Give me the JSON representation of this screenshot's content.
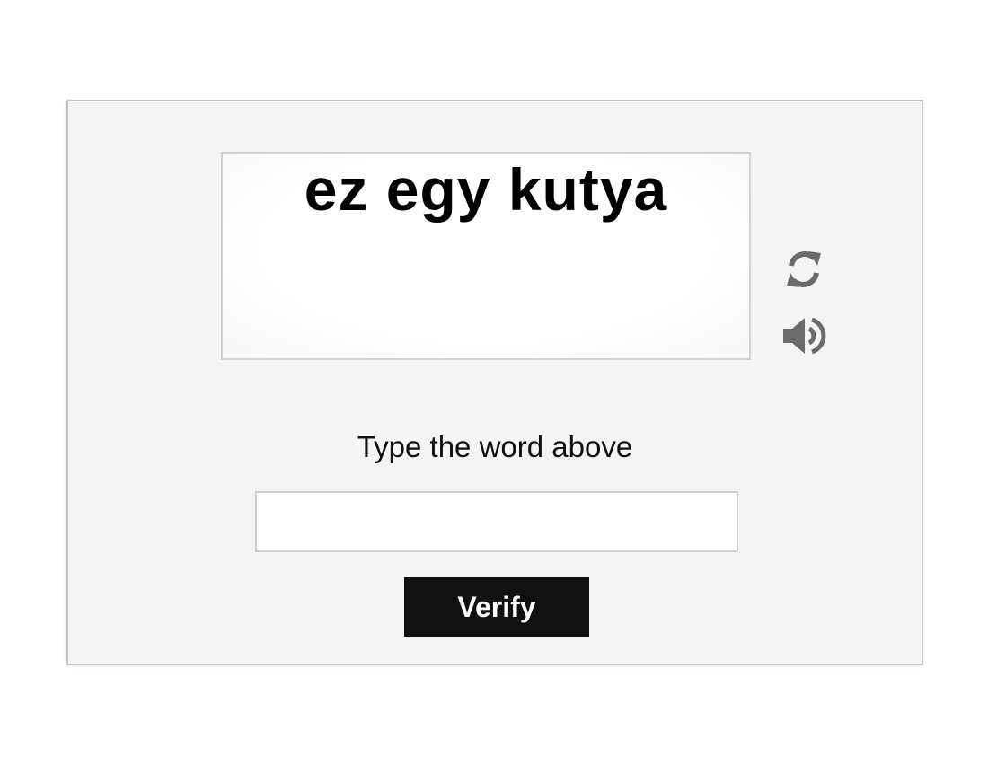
{
  "captcha": {
    "challenge_text": "ez egy kutya",
    "instruction": "Type the word above",
    "answer_value": "",
    "verify_label": "Verify",
    "icons": {
      "refresh": "refresh-icon",
      "audio": "speaker-icon"
    },
    "colors": {
      "panel_background": "#f4f4f4",
      "button_background": "#111111",
      "icon_color": "#6b6b6b"
    }
  }
}
